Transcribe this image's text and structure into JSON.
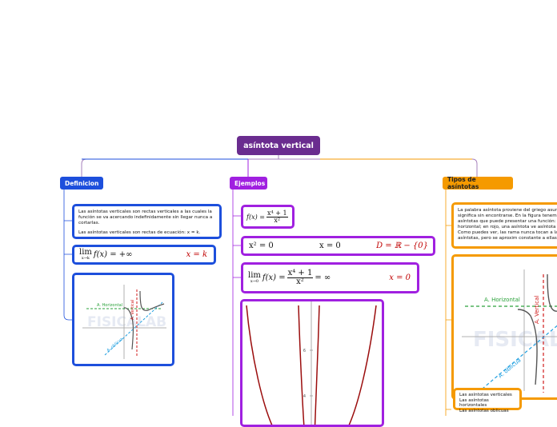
{
  "root": {
    "label": "asíntota vertical"
  },
  "branches": {
    "definicion": "Definicion",
    "ejemplos": "Ejemplos",
    "tipos": "Tipos de asíntotas"
  },
  "definicion": {
    "text1": "Las asíntotas verticales son rectas verticales a las cuales la función se va acercando indefinidamente sin llegar nunca a cortarlas.",
    "text2": "Las asíntotas verticales son rectas de ecuación: x = k.",
    "lim_word": "lim",
    "lim_sub": "x→k",
    "lim_body": "f(x) = +∞",
    "lim_result": "x = k"
  },
  "figure": {
    "label_horizontal": "A. Horizontal",
    "label_vertical": "A. Vertical",
    "label_oblicua": "A. oblicua",
    "watermark": "FISICALAB"
  },
  "ejemplos": {
    "func_lhs": "f(x) =",
    "func_num": "x⁴ + 1",
    "func_den": "x²",
    "eq1": "x² = 0",
    "eq2": "x = 0",
    "domain": "D = ℝ − {0}",
    "lim_word": "lim",
    "lim_sub": "x→0",
    "lim_lhs": "f(x) =",
    "lim_num": "x⁴ + 1",
    "lim_den": "x²",
    "lim_eq": "= ∞",
    "lim_result": "x = 0"
  },
  "graph": {
    "tick_6": "6",
    "tick_4": "4"
  },
  "tipos": {
    "text": "La palabra asíntota proviene del griego asun significa sin encontrarse. En la figura tenemo asíntotas que puede presentar una función: asíntota horizontal; en rojo, una asíntota ve asíntota oblicua. Como puedes ver, las rama nunca tocan a las asíntotas, pero se aproxim constante a ellas.",
    "list": [
      "Las asíntotas verticales",
      "Las asíntotas horizontales",
      "Las asíntotas oblicuas"
    ]
  },
  "colors": {
    "root": "#6a2c8f",
    "definicion": "#1d4fdc",
    "ejemplos": "#a020e0",
    "tipos": "#f59a00",
    "curve": "#9b0d0d"
  }
}
